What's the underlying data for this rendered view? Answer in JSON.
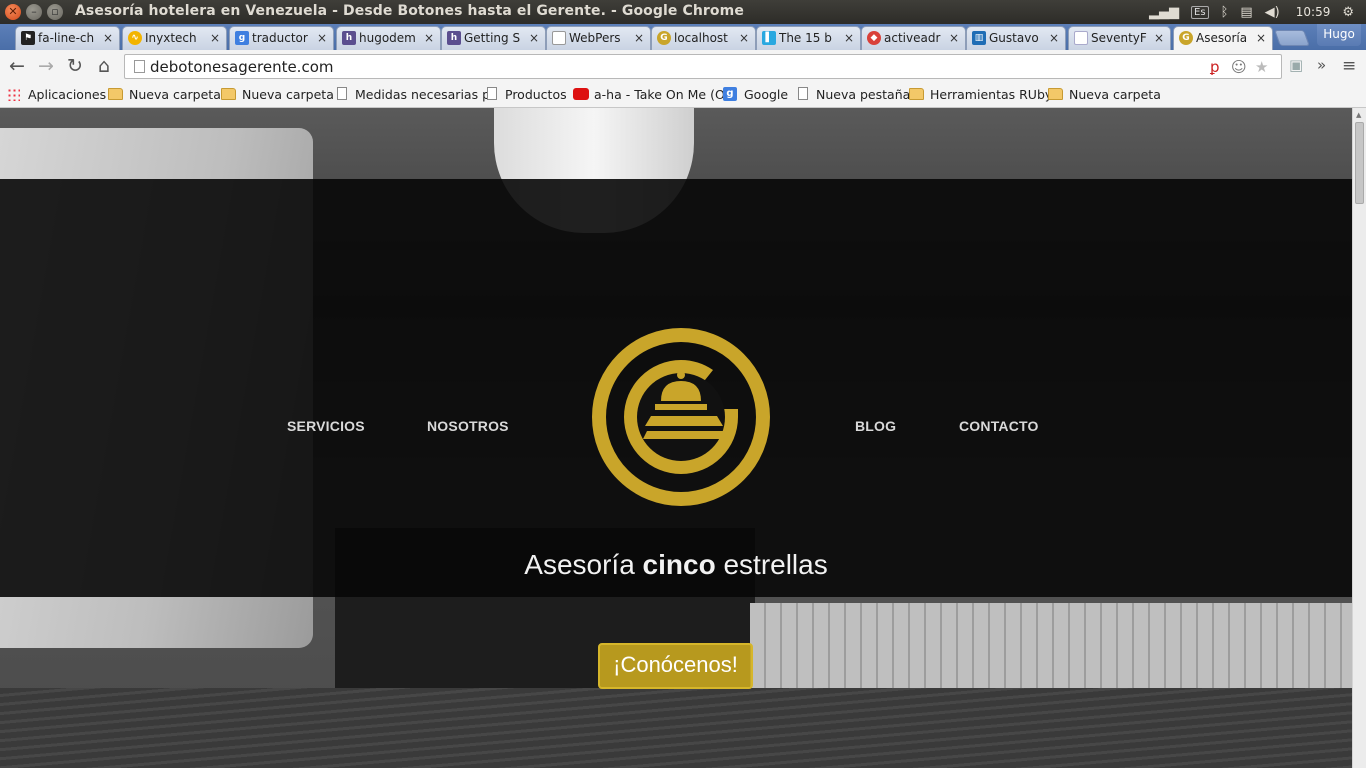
{
  "window": {
    "title": "Asesoría hotelera en Venezuela - Desde Botones hasta el Gerente. - Google Chrome",
    "clock": "10:59",
    "keyboard_layout": "Es"
  },
  "tabs": [
    {
      "label": "fa-line-ch",
      "icon": "flag-icon"
    },
    {
      "label": "Inyxtech",
      "icon": "inyxtech-icon"
    },
    {
      "label": "traductor",
      "icon": "google-icon"
    },
    {
      "label": "hugodem",
      "icon": "heroku-icon"
    },
    {
      "label": "Getting S",
      "icon": "heroku-icon"
    },
    {
      "label": "WebPers",
      "icon": "page-icon"
    },
    {
      "label": "localhost",
      "icon": "site-logo-icon"
    },
    {
      "label": "The 15 b",
      "icon": "blog-icon"
    },
    {
      "label": "activeadr",
      "icon": "activeadmin-icon"
    },
    {
      "label": "Gustavo",
      "icon": "trello-icon"
    },
    {
      "label": "SeventyF",
      "icon": "page-icon"
    },
    {
      "label": "Asesoría",
      "icon": "site-logo-icon",
      "active": true
    }
  ],
  "profile": {
    "name": "Hugo"
  },
  "address_bar": {
    "url": "debotonesagerente.com"
  },
  "bookmarks": [
    {
      "label": "Aplicaciones",
      "type": "apps"
    },
    {
      "label": "Nueva carpeta",
      "type": "folder"
    },
    {
      "label": "Nueva carpeta",
      "type": "folder"
    },
    {
      "label": "Medidas necesarias p",
      "type": "page"
    },
    {
      "label": "Productos",
      "type": "page"
    },
    {
      "label": "a-ha - Take On Me (Of",
      "type": "youtube"
    },
    {
      "label": "Google",
      "type": "google"
    },
    {
      "label": "Nueva pestaña",
      "type": "page"
    },
    {
      "label": "Herramientas RUby",
      "type": "folder"
    },
    {
      "label": "Nueva carpeta",
      "type": "folder"
    }
  ],
  "site": {
    "nav": {
      "servicios": "SERVICIOS",
      "nosotros": "NOSOTROS",
      "blog": "BLOG",
      "contacto": "CONTACTO"
    },
    "tagline_pre": "Asesoría ",
    "tagline_bold": "cinco",
    "tagline_post": " estrellas",
    "cta": "¡Conócenos!",
    "brand_color": "#c9a52a"
  }
}
